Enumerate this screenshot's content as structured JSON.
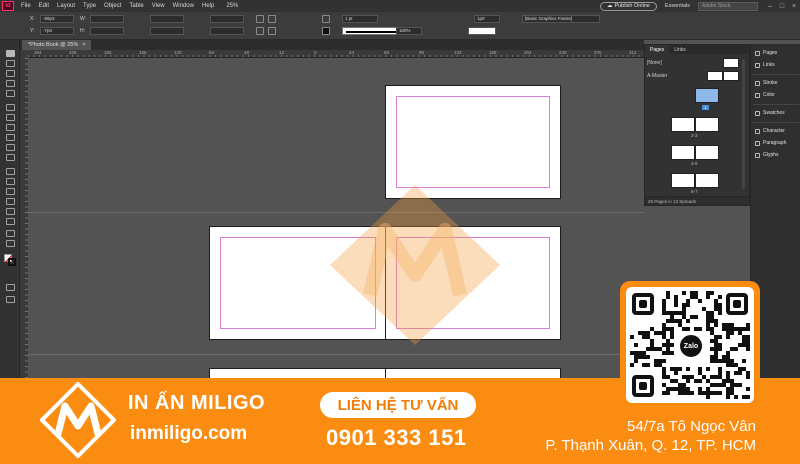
{
  "app": {
    "logo_text": "Id",
    "menu": [
      "File",
      "Edit",
      "Layout",
      "Type",
      "Object",
      "Table",
      "View",
      "Window",
      "Help"
    ],
    "zoom": "25%",
    "publish_button": "Publish Online",
    "workspace": "Essentials",
    "search_placeholder": "Adobe Stock"
  },
  "control_panel": {
    "x_label": "X:",
    "x_value": "-69p3",
    "y_label": "Y:",
    "y_value": "-7p0",
    "w_label": "W:",
    "h_label": "H:",
    "stroke_weight": "1 pt",
    "opacity": "100%",
    "offset": "1p0",
    "object_style": "[Basic Graphics Frame]"
  },
  "document": {
    "tab_title": "*Photo Book @ 25%",
    "ruler_numbers": [
      "264",
      "228",
      "192",
      "156",
      "120",
      "84",
      "48",
      "12",
      "0",
      "24",
      "60",
      "96",
      "132",
      "168",
      "204",
      "240",
      "276",
      "312"
    ]
  },
  "pages_panel": {
    "tabs": [
      "Pages",
      "Links"
    ],
    "none_label": "[None]",
    "master_label": "A-Master",
    "current_page_badge": "1",
    "spread_labels": [
      "2-3",
      "4-5",
      "6-7"
    ],
    "footer": "25 Pages in 13 Spreads"
  },
  "dock": {
    "items": [
      "Pages",
      "Links",
      "Stroke",
      "Color",
      "Swatches",
      "Character",
      "Paragraph",
      "Glyphs"
    ]
  },
  "banner": {
    "brand_name": "IN ẤN MILIGO",
    "brand_url": "inmiligo.com",
    "contact_label": "LIÊN HỆ TƯ VẤN",
    "phone": "0901 333 151",
    "address_line1": "54/7a Tô Ngọc Vân",
    "address_line2": "P. Thạnh Xuân, Q. 12, TP. HCM",
    "qr_badge": "Zalo",
    "colors": {
      "orange": "#fb8c12",
      "white": "#ffffff"
    }
  }
}
